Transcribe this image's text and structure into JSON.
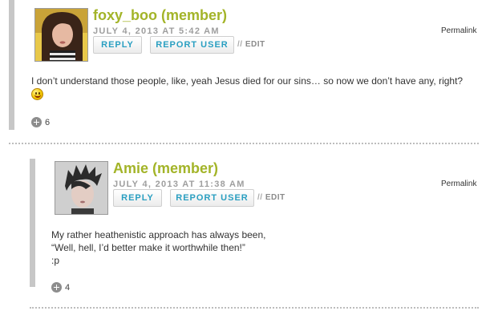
{
  "comments": [
    {
      "author": "foxy_boo (member)",
      "date": "JULY 4, 2013 AT 5:42 AM",
      "reply_label": "REPLY",
      "report_label": "REPORT USER",
      "edit_slashes": "//",
      "edit_label": "EDIT",
      "permalink": "Permalink",
      "body_lines": [
        "I don’t understand those people, like, yeah Jesus died for our sins… so now we don’t have any, right?"
      ],
      "vote_count": "6",
      "emoticon": "smiley-icon",
      "avatar": "avatar-woman-long-dark-hair"
    },
    {
      "author": "Amie (member)",
      "date": "JULY 4, 2013 AT 11:38 AM",
      "reply_label": "REPLY",
      "report_label": "REPORT USER",
      "edit_slashes": "//",
      "edit_label": "EDIT",
      "permalink": "Permalink",
      "body_lines": [
        "My rather heathenistic approach has always been,",
        "“Well, hell, I’d better make it worthwhile then!”",
        ":p"
      ],
      "vote_count": "4",
      "avatar": "avatar-person-spiky-dark-hair"
    }
  ],
  "colors": {
    "author": "#a3b428",
    "button_text": "#2a9fc1",
    "date": "#9e9e9e",
    "left_bar": "#c7c7c7"
  }
}
